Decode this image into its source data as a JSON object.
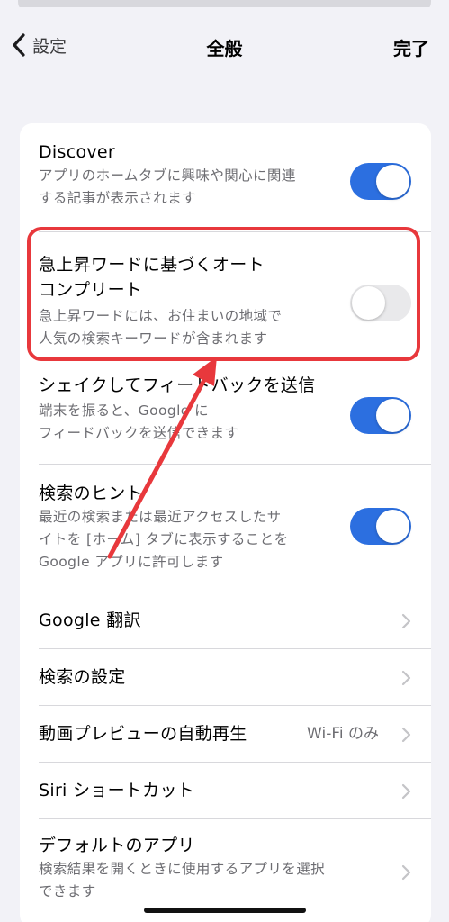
{
  "nav": {
    "back_label": "設定",
    "title": "全般",
    "done_label": "完了"
  },
  "rows": [
    {
      "title": "Discover",
      "subtitle_lines": [
        "アプリのホームタブに興味や関心に関連",
        "する記事が表示されます"
      ],
      "toggle": true
    },
    {
      "title_lines": [
        "急上昇ワードに基づくオート",
        "コンプリート"
      ],
      "subtitle_lines": [
        "急上昇ワードには、お住まいの地域で",
        "人気の検索キーワードが含まれます"
      ],
      "toggle": false
    },
    {
      "title": "シェイクしてフィードバックを送信",
      "subtitle_lines": [
        "端末を振ると、Google に",
        "フィードバックを送信できます"
      ],
      "toggle": true
    },
    {
      "title": "検索のヒント",
      "subtitle_lines": [
        "最近の検索または最近アクセスしたサ",
        "イトを [ホーム] タブに表示することを",
        "Google アプリに許可します"
      ],
      "toggle": true
    },
    {
      "title": "Google 翻訳"
    },
    {
      "title": "検索の設定"
    },
    {
      "title": "動画プレビューの自動再生",
      "value": "Wi-Fi のみ"
    },
    {
      "title": "Siri ショートカット"
    },
    {
      "title": "デフォルトのアプリ",
      "subtitle_lines": [
        "検索結果を開くときに使用するアプリを選択",
        "できます"
      ]
    }
  ],
  "colors": {
    "toggle_on": "#2c6fe0",
    "toggle_off": "#e9e9eb",
    "annotation": "#e8383c",
    "background": "#f2f2f7"
  },
  "icons": {
    "back": "chevron-left-icon",
    "disclosure": "chevron-right-icon"
  }
}
